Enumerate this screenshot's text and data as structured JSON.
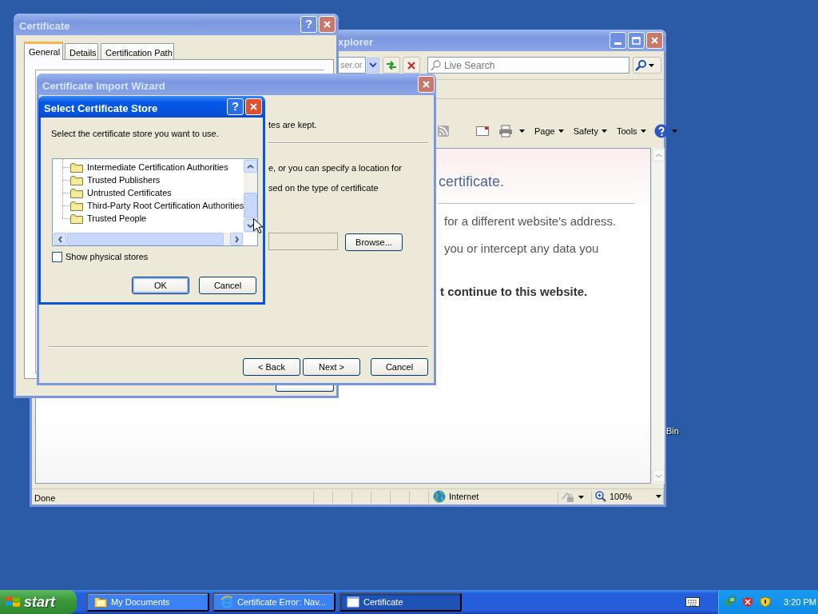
{
  "ie_window": {
    "title": "xplorer",
    "active": false,
    "address": "ser.or",
    "search": {
      "placeholder": "Live Search"
    },
    "command_bar": [
      {
        "label": "Page"
      },
      {
        "label": "Safety"
      },
      {
        "label": "Tools"
      }
    ],
    "content": {
      "heading": "certificate.",
      "lines": [
        {
          "text": "for a different website's address.",
          "bold": false
        },
        {
          "text": "you or intercept any data you",
          "bold": false
        },
        {
          "text": "t continue to this website.",
          "bold": true
        }
      ]
    },
    "status_bar": {
      "text": "Done",
      "zone": "Internet",
      "zoom": "100%"
    }
  },
  "certificate_dialog": {
    "title": "Certificate",
    "active": false,
    "help": "?",
    "tabs": [
      {
        "label": "General",
        "selected": true
      },
      {
        "label": "Details",
        "selected": false
      },
      {
        "label": "Certification Path",
        "selected": false
      }
    ]
  },
  "import_wizard": {
    "title": "Certificate Import Wizard",
    "active": false,
    "lines": [
      "tes are kept.",
      "e, or you can specify a location for",
      "sed on the type of certificate"
    ],
    "browse_button": "Browse...",
    "buttons": [
      {
        "label": "< Back"
      },
      {
        "label": "Next >"
      },
      {
        "label": "Cancel"
      }
    ]
  },
  "store_dialog": {
    "title": "Select Certificate Store",
    "active": true,
    "help": "?",
    "prompt": "Select the certificate store you want to use.",
    "stores": [
      {
        "label": "Intermediate Certification Authorities",
        "selected": false
      },
      {
        "label": "Trusted Publishers",
        "selected": false
      },
      {
        "label": "Untrusted Certificates",
        "selected": false
      },
      {
        "label": "Third-Party Root Certification Authorities",
        "selected": false
      },
      {
        "label": "Trusted People",
        "selected": false
      }
    ],
    "show_physical_stores": {
      "label": "Show physical stores",
      "checked": false
    },
    "buttons": [
      {
        "label": "OK",
        "default": true
      },
      {
        "label": "Cancel",
        "default": false
      }
    ]
  },
  "desktop_icons": [
    {
      "label": "Bin"
    }
  ],
  "taskbar": {
    "start": "start",
    "tasks": [
      {
        "label": "My Documents",
        "kind": "folder",
        "selected": false
      },
      {
        "label": "Certificate Error: Nav...",
        "kind": "browser",
        "selected": false
      },
      {
        "label": "Certificate",
        "kind": "window",
        "selected": true
      }
    ],
    "clock": "3:20 PM"
  }
}
